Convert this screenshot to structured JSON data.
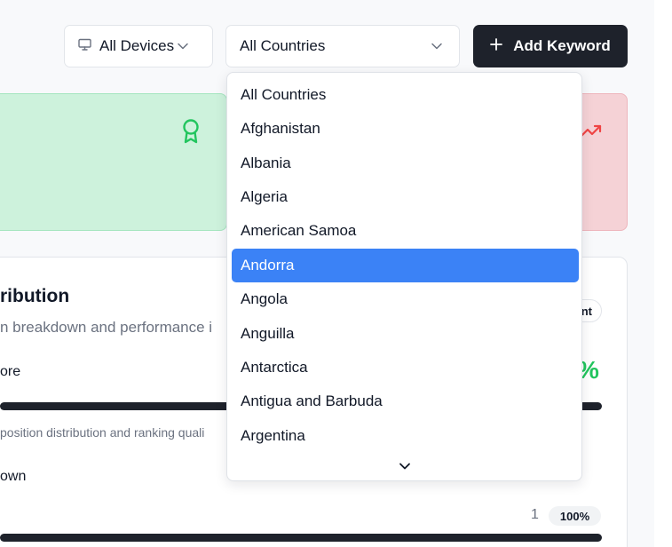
{
  "toolbar": {
    "devices_label": "All Devices",
    "countries_label": "All Countries",
    "add_label": "Add Keyword"
  },
  "country_dropdown": {
    "options": [
      "All Countries",
      "Afghanistan",
      "Albania",
      "Algeria",
      "American Samoa",
      "Andorra",
      "Angola",
      "Anguilla",
      "Antarctica",
      "Antigua and Barbuda",
      "Argentina"
    ],
    "highlighted": "Andorra"
  },
  "panel": {
    "title": "ribution",
    "subtitle": "n breakdown and performance i",
    "badge": "nt",
    "score_label": "ore",
    "score_value": "%",
    "bar_caption": "position distribution and ranking quali",
    "breakdown_label": "own",
    "row_count": "1",
    "row_percent": "100%"
  },
  "colors": {
    "accent": "#3b82f6",
    "dark": "#1e222b",
    "positive": "#22c55e",
    "negative": "#ef4444",
    "positive_card": "#cdf2dc",
    "negative_card": "#f5d2d6"
  },
  "icons": [
    "monitor-icon",
    "chevron-down-icon",
    "plus-icon",
    "award-icon",
    "trending-up-icon"
  ]
}
